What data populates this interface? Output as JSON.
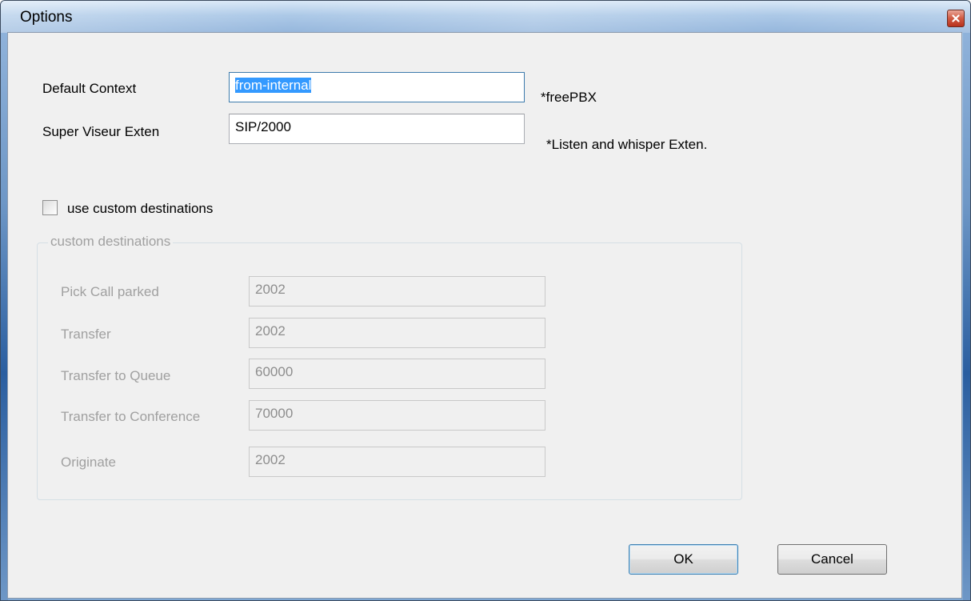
{
  "window": {
    "title": "Options"
  },
  "icons": {
    "close": "close-icon"
  },
  "fields": {
    "default_context": {
      "label": "Default Context",
      "value": "from-internal",
      "note": "*freePBX"
    },
    "super_viseur_exten": {
      "label": "Super Viseur Exten",
      "value": "SIP/2000",
      "note": "*Listen and whisper Exten."
    }
  },
  "custom_destinations_checkbox": {
    "label": "use custom destinations",
    "checked": false
  },
  "custom_destinations": {
    "legend": "custom destinations",
    "enabled": false,
    "rows": [
      {
        "label": "Pick Call parked",
        "value": "2002"
      },
      {
        "label": "Transfer",
        "value": "2002"
      },
      {
        "label": "Transfer to Queue",
        "value": "60000"
      },
      {
        "label": "Transfer to Conference",
        "value": "70000"
      },
      {
        "label": "Originate",
        "value": "2002"
      }
    ]
  },
  "buttons": {
    "ok": "OK",
    "cancel": "Cancel"
  },
  "colors": {
    "selection": "#3399ff",
    "client_bg": "#f0f0f0",
    "disabled_text": "#a0a0a0"
  }
}
